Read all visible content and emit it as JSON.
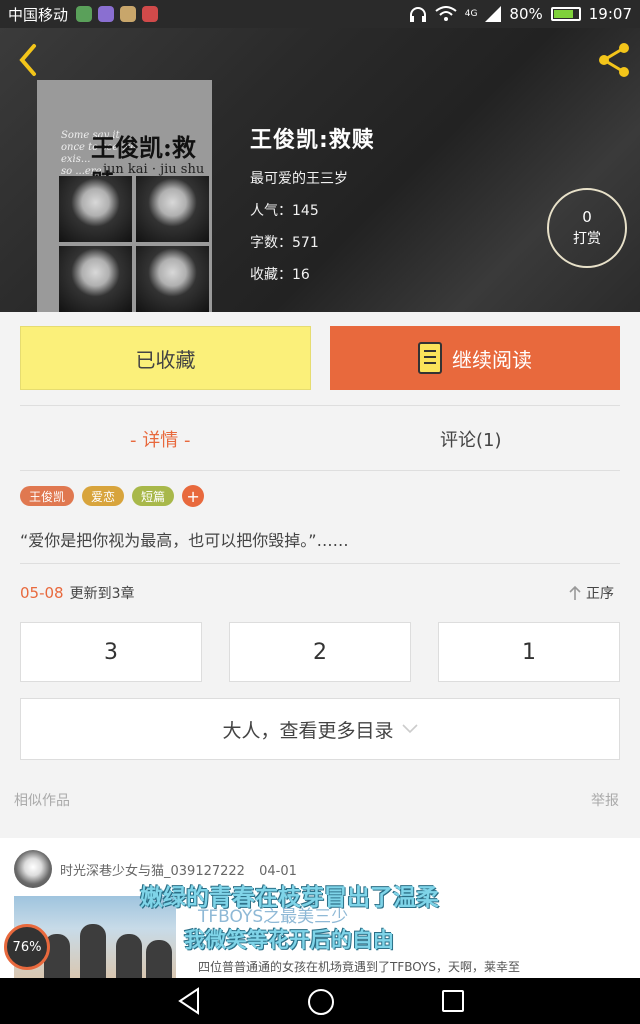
{
  "status_bar": {
    "carrier": "中国移动",
    "network": "4G",
    "battery": "80%",
    "battery_level": 0.8,
    "time": "19:07",
    "app_icon_colors": [
      "#5aa05a",
      "#8a6fd1",
      "#c8a66b",
      "#d04a4a"
    ]
  },
  "header": {
    "back_icon": "chevron-left-icon",
    "share_icon": "share-icon",
    "cover": {
      "title": "王俊凯:救赎",
      "subtitle": "jun kai · jiu shu",
      "lines": [
        "Some say it",
        "once to see wh",
        "exis...",
        "so ...ere..."
      ]
    },
    "title": "王俊凯:救赎",
    "author": "最可爱的王三岁",
    "popularity": "人气：145",
    "word_count": "字数：571",
    "favorites": "收藏：16",
    "reward": {
      "count": "0",
      "label": "打赏"
    }
  },
  "actions": {
    "collected_label": "已收藏",
    "continue_label": "继续阅读"
  },
  "tabs": {
    "detail": "- 详情 -",
    "comments": "评论(1)"
  },
  "tags": [
    {
      "label": "王俊凯",
      "color": "#e07850"
    },
    {
      "label": "爱恋",
      "color": "#d8a43c"
    },
    {
      "label": "短篇",
      "color": "#a8b84a"
    }
  ],
  "tag_add": "+",
  "quote": "“爱你是把你视为最高，也可以把你毁掉。”……",
  "update": {
    "date": "05-08",
    "text": "更新到3章"
  },
  "sort_label": "正序",
  "chapters": [
    "3",
    "2",
    "1"
  ],
  "more_catalog": "大人，查看更多目录",
  "similar_label": "相似作品",
  "report_label": "举报",
  "similar_item": {
    "author": "时光深巷少女与猫_039127222",
    "date": "04-01",
    "overlay_line1": "嫩绿的青春在枝芽冒出了温柔",
    "overlay_line2": "TFBOYS之最美三少",
    "overlay_line3": "我微笑等花开后的自由",
    "description": "四位普普通通的女孩在机场竟遇到了TFBOYS，天啊，莱幸至"
  },
  "speed_badge": "76%",
  "colors": {
    "accent": "#e8693d",
    "collected_bg": "#fbf07a"
  }
}
